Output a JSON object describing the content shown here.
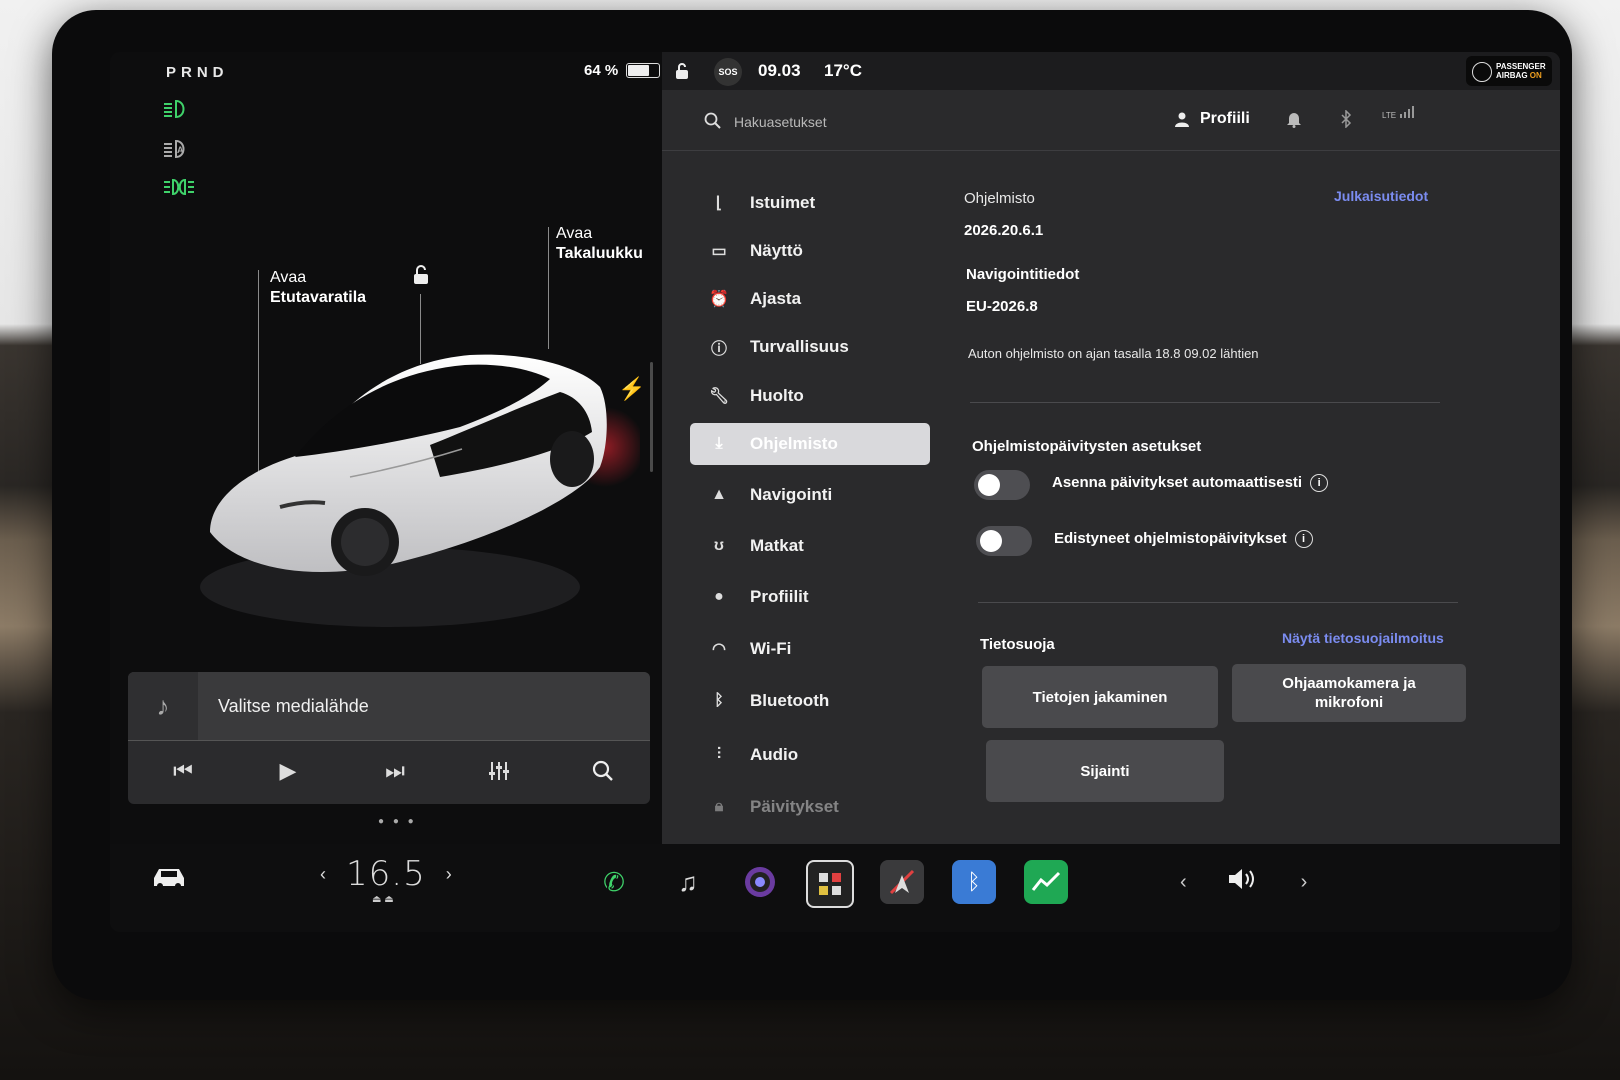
{
  "left": {
    "gear": "PRND",
    "battery": {
      "percent_text": "64 %",
      "level": 0.64
    },
    "callouts": {
      "front": {
        "line1": "Avaa",
        "line2": "Etutavaratila"
      },
      "rear": {
        "line1": "Avaa",
        "line2": "Takaluukku"
      }
    },
    "media": {
      "title": "Valitse medialähde"
    }
  },
  "status": {
    "sos": "SOS",
    "time": "09.03",
    "temp": "17°C",
    "airbag_line1": "PASSENGER",
    "airbag_line2a": "AIRBAG ",
    "airbag_line2b": "ON"
  },
  "header": {
    "search_placeholder": "Hakuasetukset",
    "profile_label": "Profiili",
    "lte": "LTE"
  },
  "menu": {
    "items": [
      {
        "label": "Istuimet",
        "icon": "seat-icon"
      },
      {
        "label": "Näyttö",
        "icon": "display-icon"
      },
      {
        "label": "Ajasta",
        "icon": "alarm-icon"
      },
      {
        "label": "Turvallisuus",
        "icon": "safety-icon"
      },
      {
        "label": "Huolto",
        "icon": "wrench-icon"
      },
      {
        "label": "Ohjelmisto",
        "icon": "download-icon",
        "active": true
      },
      {
        "label": "Navigointi",
        "icon": "navigation-icon"
      },
      {
        "label": "Matkat",
        "icon": "trips-icon"
      },
      {
        "label": "Profiilit",
        "icon": "profile-icon"
      },
      {
        "label": "Wi-Fi",
        "icon": "wifi-icon"
      },
      {
        "label": "Bluetooth",
        "icon": "bluetooth-icon"
      },
      {
        "label": "Audio",
        "icon": "audio-icon"
      },
      {
        "label": "Päivitykset",
        "icon": "lock-icon"
      }
    ]
  },
  "software": {
    "section_label": "Ohjelmisto",
    "release_notes_link": "Julkaisutiedot",
    "version": "2026.20.6.1",
    "nav_label": "Navigointitiedot",
    "nav_version": "EU-2026.8",
    "status_text": "Auton ohjelmisto on ajan tasalla 18.8 09.02 lähtien",
    "update_settings_label": "Ohjelmistopäivitysten asetukset",
    "toggle1_label": "Asenna päivitykset automaattisesti",
    "toggle2_label": "Edistyneet ohjelmistopäivitykset",
    "privacy_label": "Tietosuoja",
    "privacy_link": "Näytä tietosuojailmoitus",
    "btn_data_sharing": "Tietojen jakaminen",
    "btn_cabin_camera": "Ohjaamokamera ja mikrofoni",
    "btn_location": "Sijainti"
  },
  "dock": {
    "temp_value": "16.5",
    "volume_icon": "volume-icon"
  },
  "colors": {
    "accent_link": "#7b8cf0",
    "headlight_green": "#3fd26a",
    "active_menu": "#d9d9dc"
  }
}
